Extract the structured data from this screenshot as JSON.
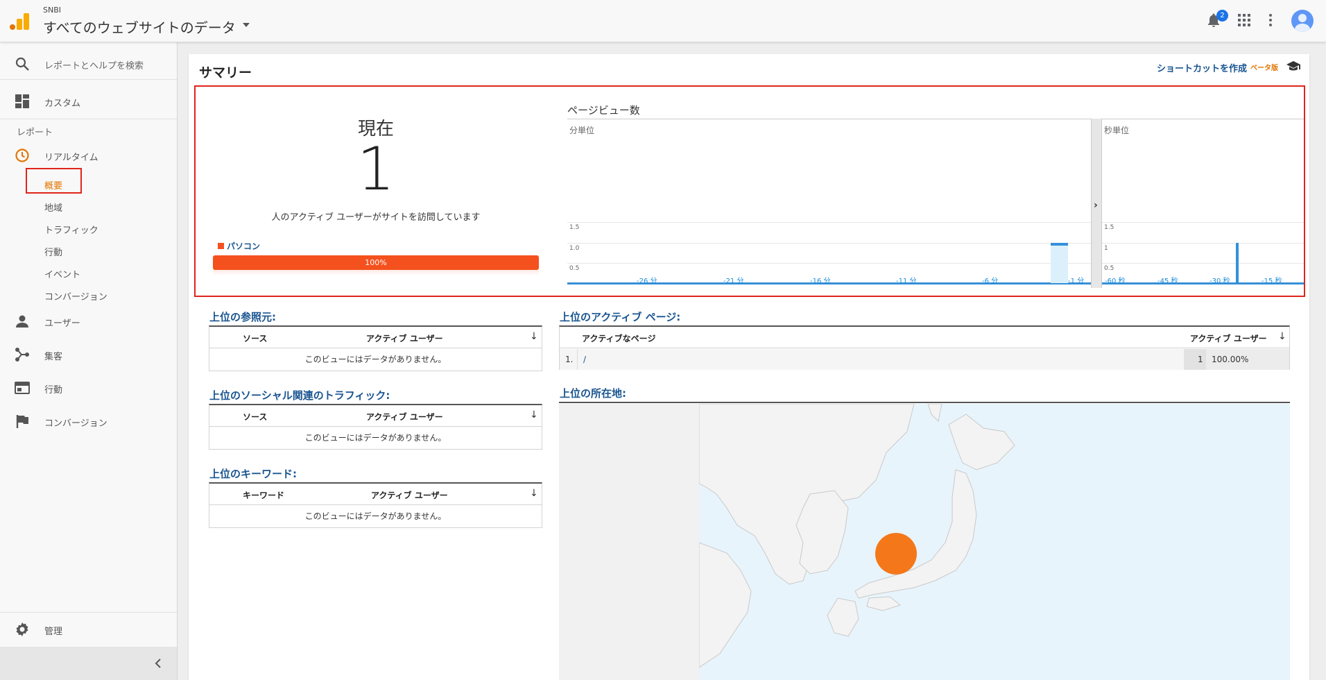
{
  "header": {
    "account": "SNBI",
    "property": "すべてのウェブサイトのデータ",
    "notifications": "2",
    "icons": [
      "bell-icon",
      "apps-icon",
      "more-vert-icon",
      "avatar"
    ]
  },
  "sidebar": {
    "search": "レポートとヘルプを検索",
    "custom": "カスタム",
    "reports_label": "レポート",
    "realtime": "リアルタイム",
    "realtime_items": [
      "概要",
      "地域",
      "トラフィック",
      "行動",
      "イベント",
      "コンバージョン"
    ],
    "sections": [
      "ユーザー",
      "集客",
      "行動",
      "コンバージョン"
    ],
    "admin": "管理"
  },
  "main": {
    "title": "サマリー",
    "shortcut": "ショートカットを作成",
    "beta": "ベータ版"
  },
  "active_now": {
    "label": "現在",
    "count": "1",
    "description": "人のアクティブ ユーザーがサイトを訪問しています",
    "device": "パソコン",
    "device_share_pct": 100,
    "device_share_label": "100%"
  },
  "pageviews": {
    "title": "ページビュー数",
    "per_minute_label": "分単位",
    "per_second_label": "秒単位",
    "chevron": "›"
  },
  "chart_data": [
    {
      "type": "bar",
      "subtitle": "分単位",
      "x_tick_labels": [
        "-26 分",
        "-21 分",
        "-16 分",
        "-11 分",
        "-6 分",
        "-1 分"
      ],
      "y_tick_labels": [
        "0.5",
        "1.0",
        "1.5"
      ],
      "ylim": [
        0,
        2
      ],
      "bars": [
        {
          "x_minutes_ago": 1,
          "value": 1
        }
      ]
    },
    {
      "type": "bar",
      "subtitle": "秒単位",
      "x_tick_labels": [
        "-60 秒",
        "-45 秒",
        "-30 秒",
        "-15 秒"
      ],
      "y_tick_labels": [
        "0.5",
        "1",
        "1.5"
      ],
      "ylim": [
        0,
        2
      ],
      "bars": [
        {
          "x_seconds_ago": 25,
          "value": 1
        }
      ]
    }
  ],
  "top_referrals": {
    "title": "上位の参照元:",
    "col_source": "ソース",
    "col_users": "アクティブ ユーザー",
    "empty": "このビューにはデータがありません。"
  },
  "top_social": {
    "title": "上位のソーシャル関連のトラフィック:",
    "col_source": "ソース",
    "col_users": "アクティブ ユーザー",
    "empty": "このビューにはデータがありません。"
  },
  "top_keywords": {
    "title": "上位のキーワード:",
    "col_keyword": "キーワード",
    "col_users": "アクティブ ユーザー",
    "empty": "このビューにはデータがありません。"
  },
  "top_pages": {
    "title": "上位のアクティブ ページ:",
    "col_page": "アクティブなページ",
    "col_users": "アクティブ ユーザー",
    "rows": [
      {
        "rank": "1.",
        "page": "/",
        "users": "1",
        "pct": "100.00%"
      }
    ]
  },
  "top_locations": {
    "title": "上位の所在地:"
  },
  "sort_icon": "↓"
}
